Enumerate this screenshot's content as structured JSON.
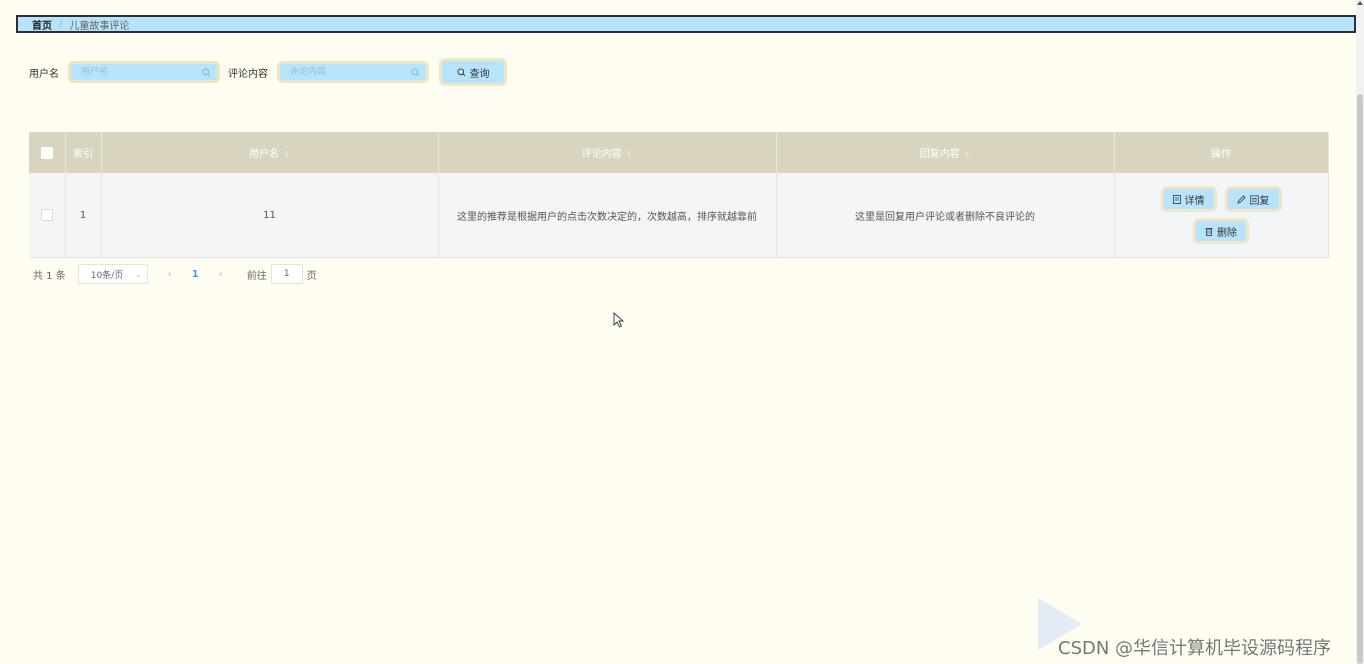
{
  "breadcrumb": {
    "home": "首页",
    "separator": "/",
    "current": "儿童故事评论"
  },
  "search": {
    "username_label": "用户名",
    "username_placeholder": "用户名",
    "comment_label": "评论内容",
    "comment_placeholder": "评论内容",
    "query_label": "查询"
  },
  "table": {
    "headers": {
      "index": "索引",
      "username": "用户名",
      "comment": "评论内容",
      "reply": "回复内容",
      "actions": "操作"
    },
    "rows": [
      {
        "index": "1",
        "username": "11",
        "comment": "这里的推荐是根据用户的点击次数决定的，次数越高，排序就越靠前",
        "reply": "这里是回复用户评论或者删除不良评论的"
      }
    ],
    "actions": {
      "detail": "详情",
      "reply": "回复",
      "delete": "删除"
    }
  },
  "pagination": {
    "total": "共 1 条",
    "page_size": "10条/页",
    "current_page": "1",
    "goto_label": "前往",
    "goto_value": "1",
    "page_suffix": "页"
  },
  "watermark": "CSDN @华信计算机毕设源码程序",
  "colors": {
    "accent": "#b7e3fb",
    "header": "#d9d4c0",
    "background": "#fffdf2",
    "border": "#efe6c7"
  }
}
